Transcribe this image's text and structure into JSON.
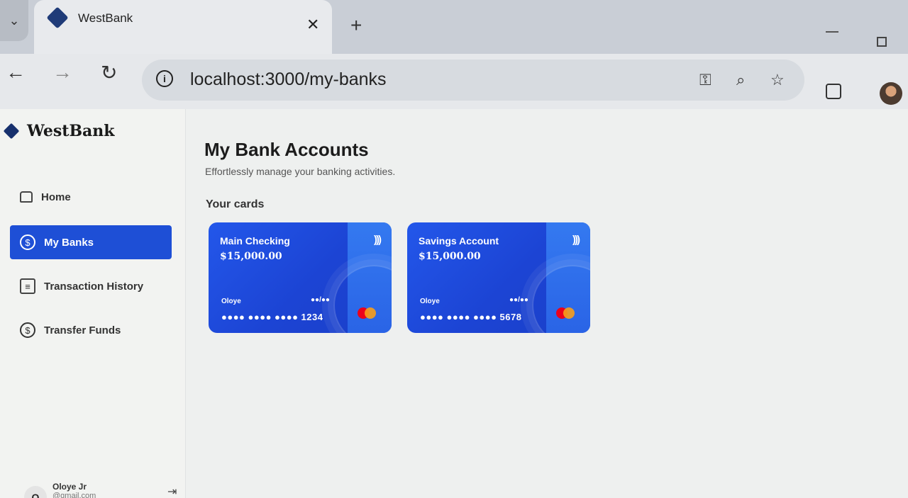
{
  "browser": {
    "tab_title": "WestBank",
    "url": "localhost:3000/my-banks"
  },
  "app": {
    "logo": "WestBank",
    "nav": [
      {
        "label": "Home",
        "icon": "home-icon",
        "active": false
      },
      {
        "label": "My Banks",
        "icon": "dollar-icon",
        "active": true
      },
      {
        "label": "Transaction History",
        "icon": "receipt-icon",
        "active": false
      },
      {
        "label": "Transfer Funds",
        "icon": "transfer-icon",
        "active": false
      }
    ],
    "user": {
      "initial": "O",
      "name": "Oloye Jr",
      "email": "@gmail.com"
    }
  },
  "main": {
    "title": "My Bank Accounts",
    "subtitle": "Effortlessly manage your banking activities.",
    "cards_heading": "Your cards",
    "cards": [
      {
        "name": "Main Checking",
        "balance": "$15,000.00",
        "holder": "Oloye",
        "expiry": "●●/●●",
        "number": "●●●● ●●●● ●●●● 1234"
      },
      {
        "name": "Savings Account",
        "balance": "$15,000.00",
        "holder": "Oloye",
        "expiry": "●●/●●",
        "number": "●●●● ●●●● ●●●● 5678"
      }
    ]
  },
  "colors": {
    "accent": "#1e4fd6",
    "brand": "#17306d"
  }
}
